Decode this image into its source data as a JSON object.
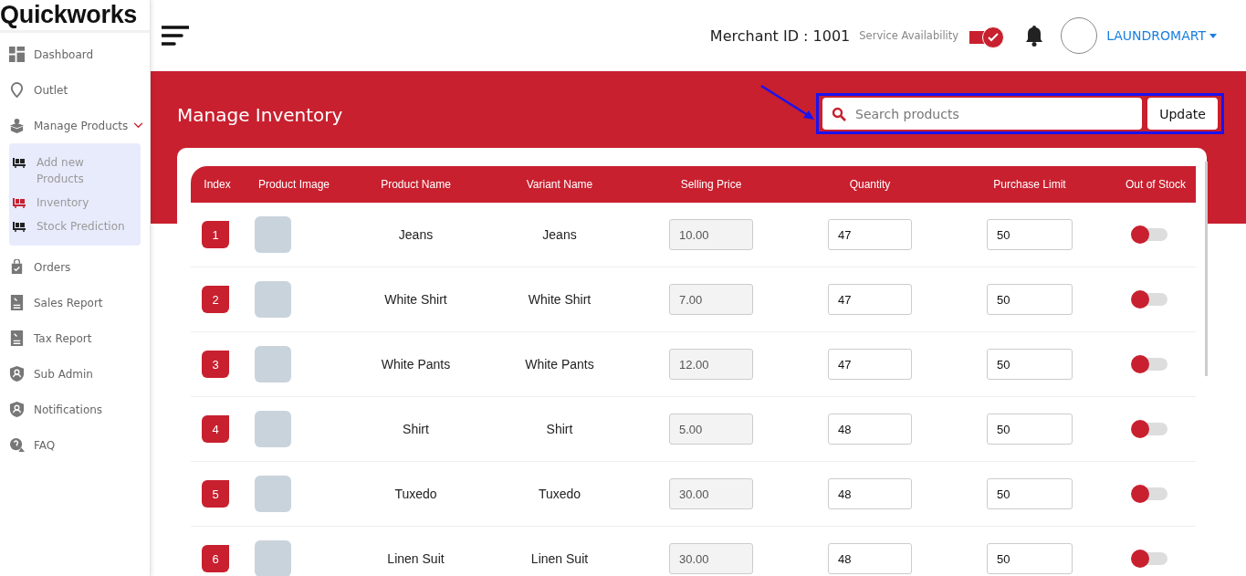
{
  "logo": "Quickworks",
  "sidebar": {
    "items": [
      {
        "label": "Dashboard",
        "kind": "grid"
      },
      {
        "label": "Outlet",
        "kind": "pin"
      },
      {
        "label": "Manage Products",
        "kind": "box",
        "expanded": true,
        "children": [
          {
            "label": "Add new Products",
            "selected": false
          },
          {
            "label": "Inventory",
            "selected": true
          },
          {
            "label": "Stock Prediction",
            "selected": false
          }
        ]
      },
      {
        "label": "Orders",
        "kind": "bag"
      },
      {
        "label": "Sales Report",
        "kind": "report"
      },
      {
        "label": "Tax Report",
        "kind": "report"
      },
      {
        "label": "Sub Admin",
        "kind": "shield"
      },
      {
        "label": "Notifications",
        "kind": "shield"
      },
      {
        "label": "FAQ",
        "kind": "faq"
      }
    ]
  },
  "header": {
    "merchant_id": "Merchant ID : 1001",
    "service_label": "Service Availability",
    "service_on": true,
    "account": "LAUNDROMART"
  },
  "page": {
    "title": "Manage Inventory",
    "search": {
      "placeholder": "Search products"
    },
    "update_button": "Update"
  },
  "table": {
    "columns": [
      "Index",
      "Product Image",
      "Product Name",
      "Variant Name",
      "Selling Price",
      "Quantity",
      "Purchase Limit",
      "Out of Stock"
    ],
    "rows": [
      {
        "index": "1",
        "product": "Jeans",
        "variant": "Jeans",
        "price": "10.00",
        "quantity": "47",
        "limit": "50",
        "out_of_stock": false
      },
      {
        "index": "2",
        "product": "White Shirt",
        "variant": "White Shirt",
        "price": "7.00",
        "quantity": "47",
        "limit": "50",
        "out_of_stock": false
      },
      {
        "index": "3",
        "product": "White Pants",
        "variant": "White Pants",
        "price": "12.00",
        "quantity": "47",
        "limit": "50",
        "out_of_stock": false
      },
      {
        "index": "4",
        "product": "Shirt",
        "variant": "Shirt",
        "price": "5.00",
        "quantity": "48",
        "limit": "50",
        "out_of_stock": false
      },
      {
        "index": "5",
        "product": "Tuxedo",
        "variant": "Tuxedo",
        "price": "30.00",
        "quantity": "48",
        "limit": "50",
        "out_of_stock": false
      },
      {
        "index": "6",
        "product": "Linen Suit",
        "variant": "Linen Suit",
        "price": "30.00",
        "quantity": "48",
        "limit": "50",
        "out_of_stock": false
      }
    ]
  }
}
